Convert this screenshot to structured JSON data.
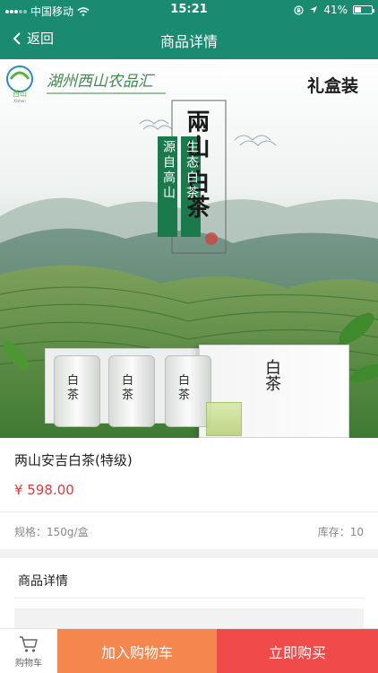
{
  "status_bar": {
    "carrier": "中国移动",
    "time": "15:21",
    "battery": "41%",
    "battery_level": 0.41
  },
  "nav": {
    "back_label": "返回",
    "title": "商品详情"
  },
  "hero": {
    "brand_text": "湖州西山农品汇",
    "logo_text": "西山",
    "logo_subtext": "Xishan",
    "gift_label": "礼盒装",
    "banner_main": "兩山·白茶",
    "banner_side_left": "源自高山",
    "banner_side_right": "生态白茶",
    "tin_label": "白茶",
    "box_label": "白茶"
  },
  "product": {
    "name": "两山安吉白茶(特级)",
    "price": "¥ 598.00",
    "spec": "规格：150g/盒",
    "stock": "库存：10"
  },
  "detail": {
    "title": "商品详情"
  },
  "bottom_bar": {
    "cart_label": "购物车",
    "add_to_cart": "加入购物车",
    "buy_now": "立即购买"
  },
  "colors": {
    "header": "#1a8a70",
    "price": "#e5383b",
    "add_to_cart": "#f4864e",
    "buy_now": "#f04a4a"
  }
}
